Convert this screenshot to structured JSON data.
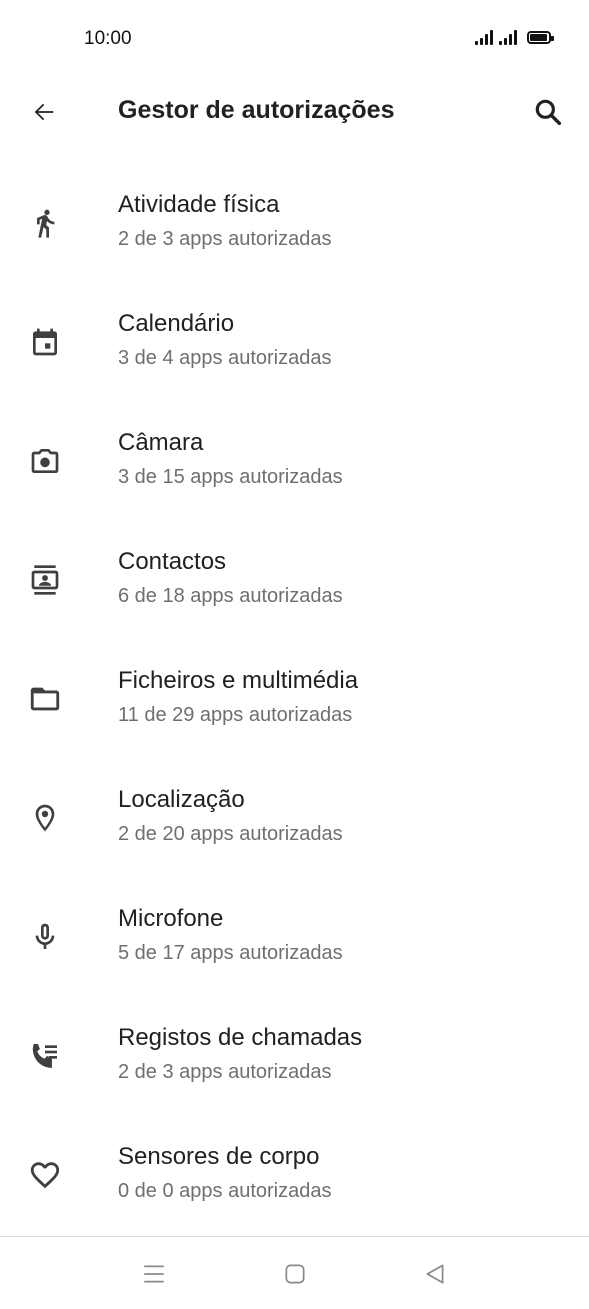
{
  "status_bar": {
    "time": "10:00",
    "battery_level": 1.0
  },
  "app_bar": {
    "title": "Gestor de autorizações",
    "back_icon": "arrow-back-icon",
    "search_icon": "search-icon"
  },
  "permissions": [
    {
      "title": "Atividade física",
      "subtitle": "2 de 3 apps autorizadas",
      "icon": "activity-icon"
    },
    {
      "title": "Calendário",
      "subtitle": "3 de 4 apps autorizadas",
      "icon": "calendar-icon"
    },
    {
      "title": "Câmara",
      "subtitle": "3 de 15 apps autorizadas",
      "icon": "camera-icon"
    },
    {
      "title": "Contactos",
      "subtitle": "6 de 18 apps autorizadas",
      "icon": "contacts-icon"
    },
    {
      "title": "Ficheiros e multimédia",
      "subtitle": "11 de 29 apps autorizadas",
      "icon": "folder-icon"
    },
    {
      "title": "Localização",
      "subtitle": "2 de 20 apps autorizadas",
      "icon": "location-icon"
    },
    {
      "title": "Microfone",
      "subtitle": "5 de 17 apps autorizadas",
      "icon": "microphone-icon"
    },
    {
      "title": "Registos de chamadas",
      "subtitle": "2 de 3 apps autorizadas",
      "icon": "call-log-icon"
    },
    {
      "title": "Sensores de corpo",
      "subtitle": "0 de 0 apps autorizadas",
      "icon": "heart-icon"
    }
  ],
  "nav_bar": {
    "menu_icon": "menu-icon",
    "home_icon": "home-icon",
    "back_icon": "back-triangle-icon"
  },
  "colors": {
    "text_primary": "#202124",
    "text_secondary": "#6f6f6f",
    "icon": "#3c4043",
    "divider": "#dcdcdc"
  }
}
